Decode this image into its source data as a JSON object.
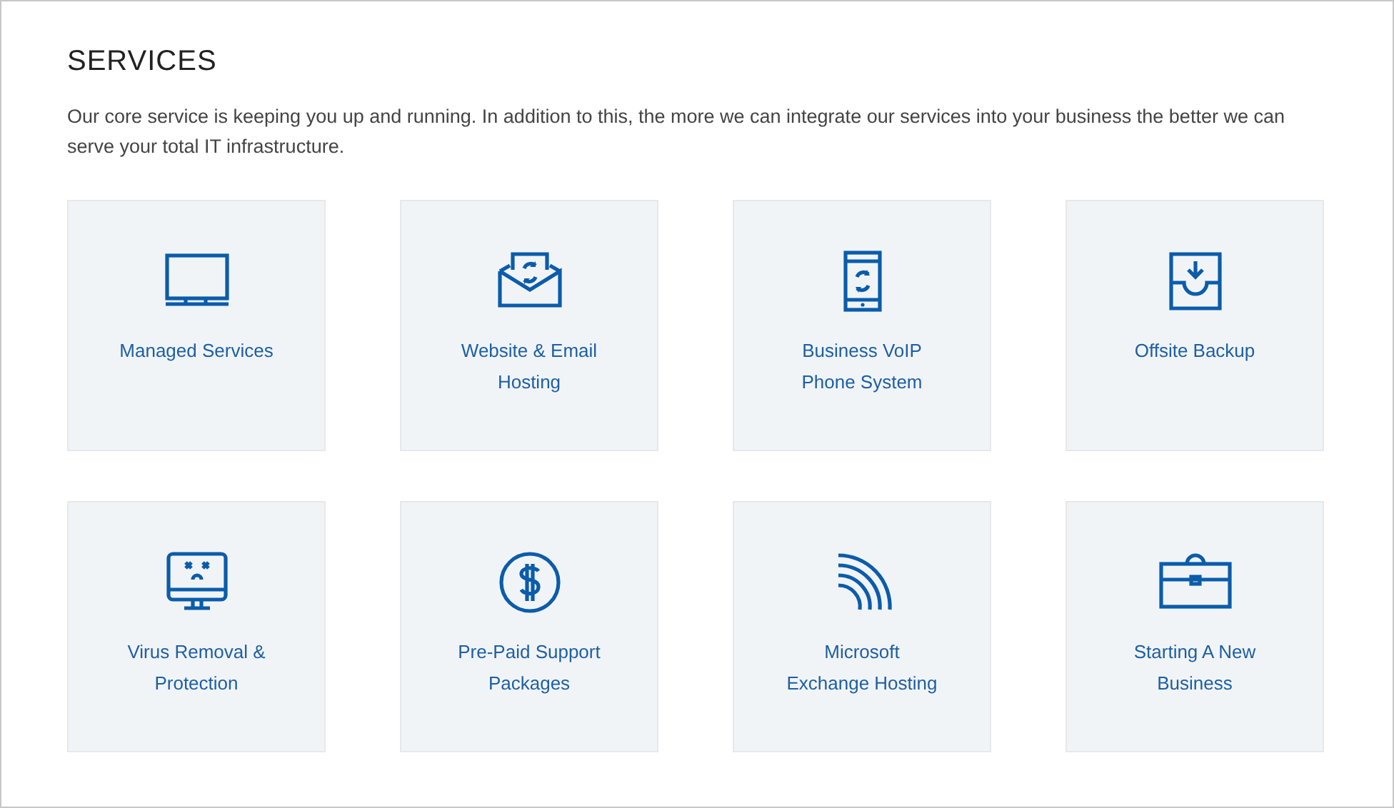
{
  "section": {
    "title": "SERVICES",
    "intro": "Our core service is keeping you up and running.  In addition to this, the more we can integrate our services into your business the better we can serve your total IT infrastructure."
  },
  "services": [
    {
      "label": "Managed Services"
    },
    {
      "label": "Website & Email Hosting"
    },
    {
      "label": "Business VoIP Phone System"
    },
    {
      "label": "Offsite Backup"
    },
    {
      "label": "Virus Removal & Protection"
    },
    {
      "label": "Pre-Paid Support Packages"
    },
    {
      "label": "Microsoft Exchange Hosting"
    },
    {
      "label": "Starting A New Business"
    }
  ]
}
